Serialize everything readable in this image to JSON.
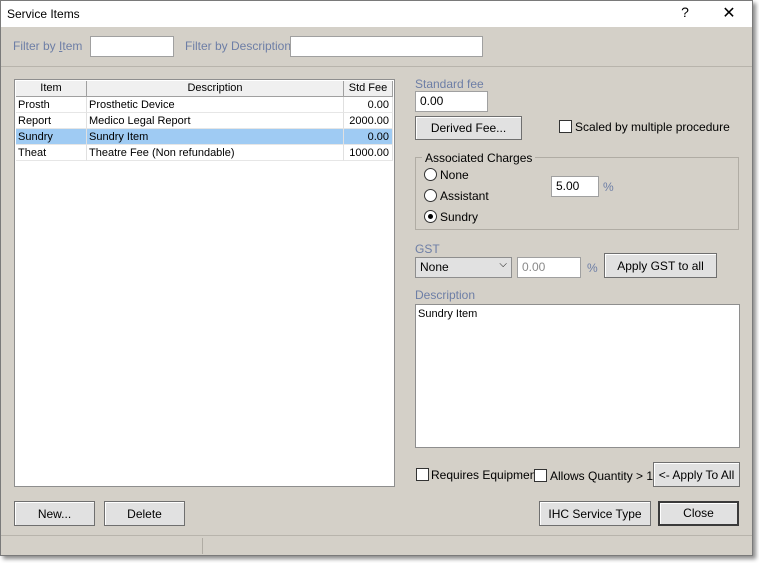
{
  "window": {
    "title": "Service Items",
    "help_label": "?",
    "close_label": "✕"
  },
  "filters": {
    "item_label_prefix": "Filter by ",
    "item_label_accel": "I",
    "item_label_rest": "tem",
    "item_value": "",
    "description_label": "Filter by Description",
    "description_value": ""
  },
  "list": {
    "columns": [
      "Item",
      "Description",
      "Std Fee"
    ],
    "rows": [
      {
        "item": "Prosth",
        "description": "Prosthetic Device",
        "fee": "0.00"
      },
      {
        "item": "Report",
        "description": "Medico Legal Report",
        "fee": "2000.00"
      },
      {
        "item": "Sundry",
        "description": "Sundry Item",
        "fee": "0.00"
      },
      {
        "item": "Theat",
        "description": "Theatre Fee (Non refundable)",
        "fee": "1000.00"
      }
    ],
    "selected_index": 2
  },
  "details": {
    "standard_fee_label": "Standard fee",
    "standard_fee_value": "0.00",
    "derived_fee_button": "Derived Fee...",
    "scaled_label": "Scaled by multiple procedure",
    "scaled_checked": false,
    "associated_charges": {
      "title": "Associated Charges",
      "options": [
        "None",
        "Assistant",
        "Sundry"
      ],
      "selected": "Sundry",
      "percent_value": "5.00",
      "percent_symbol": "%"
    },
    "gst": {
      "label": "GST",
      "selected": "None",
      "value": "0.00",
      "percent_symbol": "%",
      "apply_button": "Apply GST to all"
    },
    "description_label": "Description",
    "description_value": "Sundry Item",
    "requires_equipment_label": "Requires Equipment",
    "requires_equipment_checked": false,
    "allows_quantity_label": "Allows Quantity > 1",
    "allows_quantity_checked": false,
    "apply_to_all_button": "<- Apply To All"
  },
  "footer": {
    "new_button": "New...",
    "delete_button": "Delete",
    "ihc_button": "IHC Service Type",
    "close_button": "Close"
  },
  "colors": {
    "selection": "#9fcbf3",
    "label_blue": "#6d7ea6",
    "dialog_bg": "#d4d0c8"
  },
  "icons": {
    "help": "question-mark-icon",
    "close": "close-x-icon",
    "combo": "chevron-down-icon"
  }
}
